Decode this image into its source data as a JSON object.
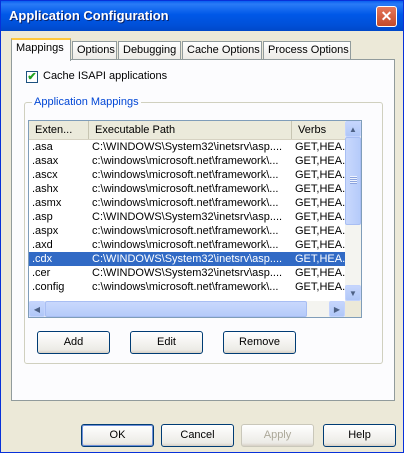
{
  "window": {
    "title": "Application Configuration",
    "close_glyph": "✕"
  },
  "tabs": [
    {
      "label": "Mappings",
      "active": true
    },
    {
      "label": "Options",
      "active": false
    },
    {
      "label": "Debugging",
      "active": false
    },
    {
      "label": "Cache Options",
      "active": false
    },
    {
      "label": "Process Options",
      "active": false
    }
  ],
  "cache_isapi": {
    "label": "Cache ISAPI applications",
    "checked": true,
    "check_glyph": "✔"
  },
  "group": {
    "legend": "Application Mappings"
  },
  "listview": {
    "columns": [
      "Exten...",
      "Executable Path",
      "Verbs"
    ],
    "rows": [
      {
        "ext": ".asa",
        "path": "C:\\WINDOWS\\System32\\inetsrv\\asp....",
        "verbs": "GET,HEA..."
      },
      {
        "ext": ".asax",
        "path": "c:\\windows\\microsoft.net\\framework\\...",
        "verbs": "GET,HEA..."
      },
      {
        "ext": ".ascx",
        "path": "c:\\windows\\microsoft.net\\framework\\...",
        "verbs": "GET,HEA..."
      },
      {
        "ext": ".ashx",
        "path": "c:\\windows\\microsoft.net\\framework\\...",
        "verbs": "GET,HEA..."
      },
      {
        "ext": ".asmx",
        "path": "c:\\windows\\microsoft.net\\framework\\...",
        "verbs": "GET,HEA..."
      },
      {
        "ext": ".asp",
        "path": "C:\\WINDOWS\\System32\\inetsrv\\asp....",
        "verbs": "GET,HEA..."
      },
      {
        "ext": ".aspx",
        "path": "c:\\windows\\microsoft.net\\framework\\...",
        "verbs": "GET,HEA..."
      },
      {
        "ext": ".axd",
        "path": "c:\\windows\\microsoft.net\\framework\\...",
        "verbs": "GET,HEA..."
      },
      {
        "ext": ".cdx",
        "path": "C:\\WINDOWS\\System32\\inetsrv\\asp....",
        "verbs": "GET,HEA...",
        "selected": true
      },
      {
        "ext": ".cer",
        "path": "C:\\WINDOWS\\System32\\inetsrv\\asp....",
        "verbs": "GET,HEA..."
      },
      {
        "ext": ".config",
        "path": "c:\\windows\\microsoft.net\\framework\\...",
        "verbs": "GET,HEA..."
      }
    ],
    "scroll_up_glyph": "▲",
    "scroll_down_glyph": "▼",
    "scroll_left_glyph": "◀",
    "scroll_right_glyph": "▶"
  },
  "mapping_buttons": {
    "add": "Add",
    "edit": "Edit",
    "remove": "Remove"
  },
  "dialog_buttons": {
    "ok": "OK",
    "cancel": "Cancel",
    "apply": "Apply",
    "help": "Help"
  }
}
